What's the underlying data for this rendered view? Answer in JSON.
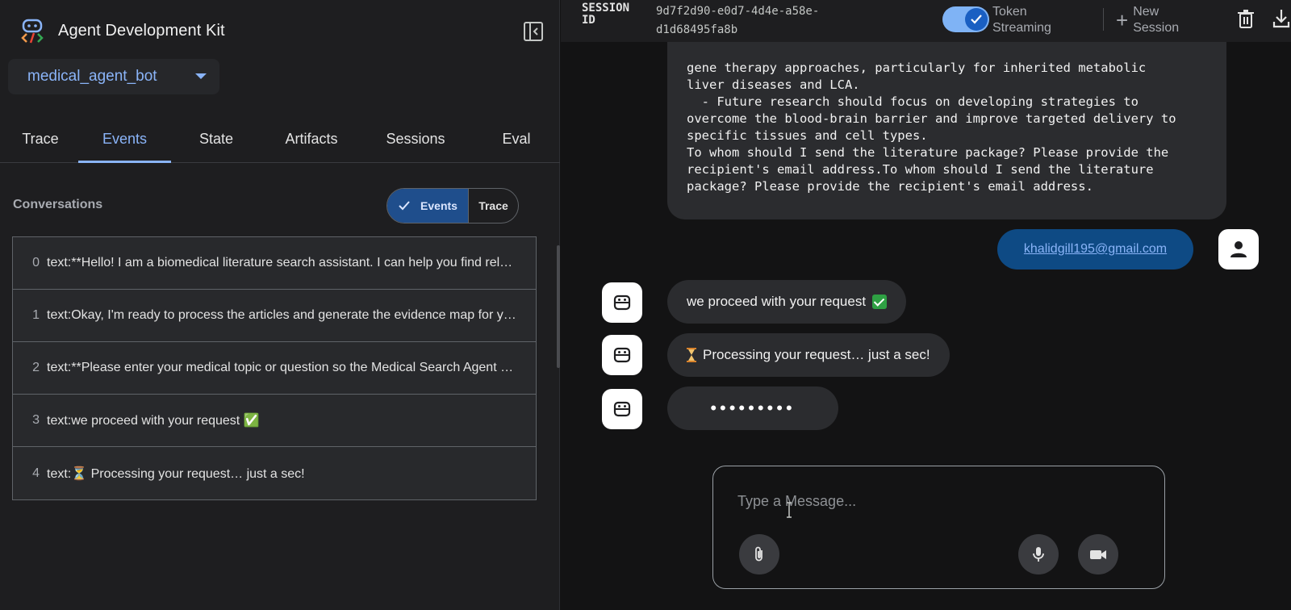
{
  "app": {
    "title": "Agent Development Kit"
  },
  "agent_selector": {
    "value": "medical_agent_bot"
  },
  "tabs": [
    {
      "label": "Trace",
      "active": false
    },
    {
      "label": "Events",
      "active": true
    },
    {
      "label": "State",
      "active": false
    },
    {
      "label": "Artifacts",
      "active": false
    },
    {
      "label": "Sessions",
      "active": false
    },
    {
      "label": "Eval",
      "active": false
    }
  ],
  "conversations": {
    "label": "Conversations",
    "view_toggle": {
      "events": "Events",
      "trace": "Trace",
      "selected": "Events"
    },
    "events": [
      {
        "index": "0",
        "text": "text:**Hello! I am a biomedical literature search assistant. I can help you find relevant biomedical articles, summarize key findings and generate evidence maps."
      },
      {
        "index": "1",
        "text": "text:Okay, I'm ready to process the articles and generate the evidence map for you."
      },
      {
        "index": "2",
        "text": "text:**Please enter your medical topic or question so the Medical Search Agent can begin."
      },
      {
        "index": "3",
        "text": "text:we proceed with your request ✅"
      },
      {
        "index": "4",
        "text": "text:⏳ Processing your request… just a sec!"
      }
    ]
  },
  "session": {
    "label": "SESSION ID",
    "id_line1": "9d7f2d90-e0d7-4d4e-a58e-",
    "id_line2": "d1d68495fa8b"
  },
  "token_streaming": {
    "label_line1": "Token",
    "label_line2": "Streaming",
    "enabled": true
  },
  "new_session": {
    "label_line1": "New",
    "label_line2": "Session"
  },
  "chat": {
    "bot_long_message": "gene therapy approaches, particularly for inherited metabolic\nliver diseases and LCA.\n  - Future research should focus on developing strategies to\novercome the blood-brain barrier and improve targeted delivery to\nspecific tissues and cell types.\nTo whom should I send the literature package? Please provide the\nrecipient's email address.To whom should I send the literature\npackage? Please provide the recipient's email address.",
    "user_message": "khalidgill195@gmail.com",
    "bot_messages": [
      {
        "text": "we proceed with your request",
        "emoji": "check"
      },
      {
        "text": "Processing your request… just a sec!",
        "emoji": "hourglass"
      }
    ],
    "typing_indicator": "•••••••••"
  },
  "composer": {
    "placeholder": "Type a Message..."
  },
  "icons": {
    "logo": "adk-logo-icon",
    "collapse": "sidebar-collapse-icon",
    "dropdown": "chevron-down-icon",
    "check": "check-icon",
    "plus": "plus-icon",
    "trash": "trash-icon",
    "download": "download-icon",
    "user": "person-icon",
    "bot": "robot-icon",
    "attach": "paperclip-icon",
    "mic": "microphone-icon",
    "video": "video-camera-icon"
  },
  "colors": {
    "accent": "#8ab4f8",
    "user_bubble": "#0e4a84",
    "toggle_on": "#1f4e8c",
    "panel": "#1e1e20",
    "background": "#131314"
  }
}
